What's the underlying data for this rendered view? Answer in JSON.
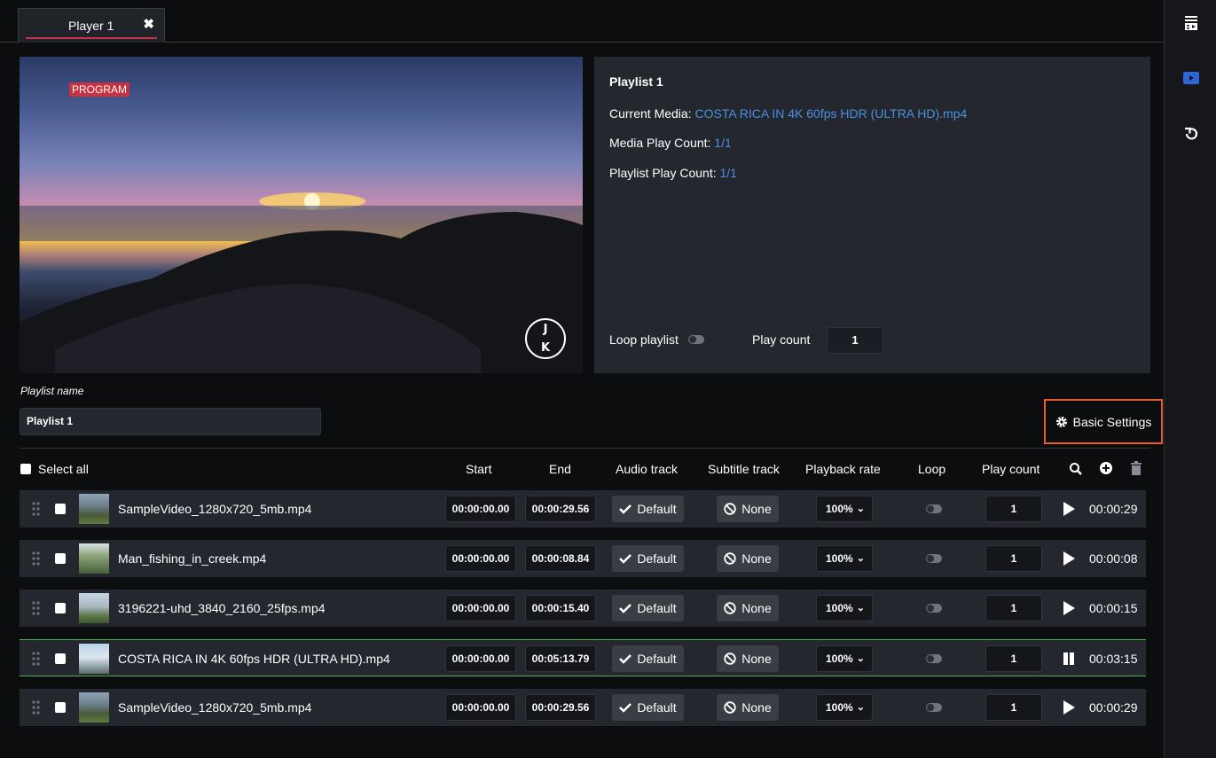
{
  "tab": {
    "label": "Player 1",
    "close": "✖"
  },
  "preview": {
    "badge": "PROGRAM",
    "logo_top": "J",
    "logo_bottom": "K"
  },
  "info": {
    "title": "Playlist 1",
    "current_media_label": "Current Media:",
    "current_media_value": "COSTA RICA IN 4K 60fps HDR (ULTRA HD).mp4",
    "media_play_count_label": "Media Play Count:",
    "media_play_count_value": "1/1",
    "playlist_play_count_label": "Playlist Play Count:",
    "playlist_play_count_value": "1/1",
    "loop_playlist_label": "Loop playlist",
    "play_count_label": "Play count",
    "play_count_value": "1"
  },
  "playlist_name": {
    "label": "Playlist name",
    "value": "Playlist 1"
  },
  "basic_settings_label": "Basic Settings",
  "header": {
    "select_all": "Select all",
    "start": "Start",
    "end": "End",
    "audio_track": "Audio track",
    "subtitle_track": "Subtitle track",
    "playback_rate": "Playback rate",
    "loop": "Loop",
    "play_count": "Play count"
  },
  "rows": [
    {
      "name": "SampleVideo_1280x720_5mb.mp4",
      "start": "00:00:00.00",
      "end": "00:00:29.56",
      "audio": "Default",
      "subtitle": "None",
      "rate": "100%",
      "count": "1",
      "state": "play",
      "duration": "00:00:29",
      "thumb": "robot"
    },
    {
      "name": "Man_fishing_in_creek.mp4",
      "start": "00:00:00.00",
      "end": "00:00:08.84",
      "audio": "Default",
      "subtitle": "None",
      "rate": "100%",
      "count": "1",
      "state": "play",
      "duration": "00:00:08",
      "thumb": "creek"
    },
    {
      "name": "3196221-uhd_3840_2160_25fps.mp4",
      "start": "00:00:00.00",
      "end": "00:00:15.40",
      "audio": "Default",
      "subtitle": "None",
      "rate": "100%",
      "count": "1",
      "state": "play",
      "duration": "00:00:15",
      "thumb": "city"
    },
    {
      "name": "COSTA RICA IN 4K 60fps HDR (ULTRA HD).mp4",
      "start": "00:00:00.00",
      "end": "00:05:13.79",
      "audio": "Default",
      "subtitle": "None",
      "rate": "100%",
      "count": "1",
      "state": "pause",
      "duration": "00:03:15",
      "thumb": "coast"
    },
    {
      "name": "SampleVideo_1280x720_5mb.mp4",
      "start": "00:00:00.00",
      "end": "00:00:29.56",
      "audio": "Default",
      "subtitle": "None",
      "rate": "100%",
      "count": "1",
      "state": "play",
      "duration": "00:00:29",
      "thumb": "robot"
    }
  ],
  "colors": {
    "accent_link": "#4a90e2",
    "program_badge": "#c8313f",
    "active_row_border": "#4caf50",
    "highlight_border": "#e85d2a"
  }
}
